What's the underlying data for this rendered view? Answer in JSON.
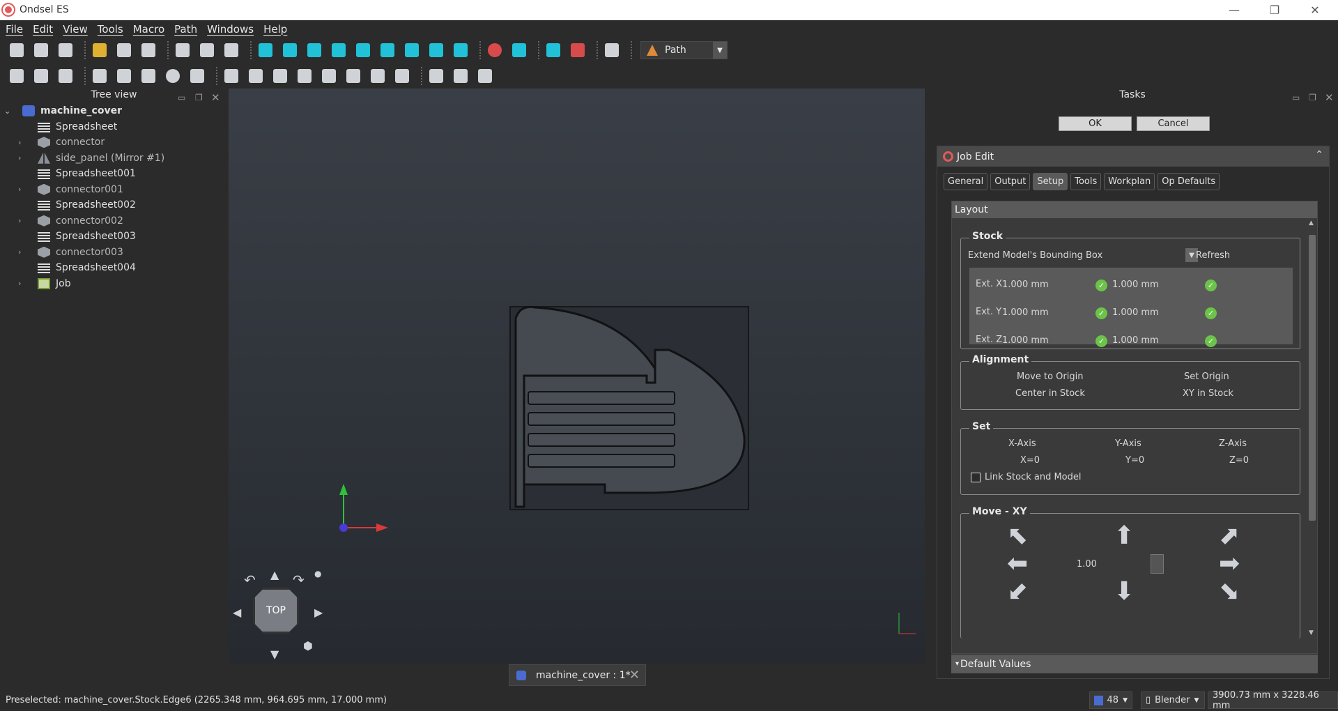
{
  "app": {
    "title": "Ondsel ES"
  },
  "menu": [
    "File",
    "Edit",
    "View",
    "Tools",
    "Macro",
    "Path",
    "Windows",
    "Help"
  ],
  "toolbar": {
    "workbench": "Path"
  },
  "tree": {
    "header": "Tree view",
    "items": [
      {
        "label": "machine_cover",
        "root": true
      },
      {
        "label": "Spreadsheet"
      },
      {
        "label": "connector"
      },
      {
        "label": "side_panel (Mirror #1)"
      },
      {
        "label": "Spreadsheet001"
      },
      {
        "label": "connector001"
      },
      {
        "label": "Spreadsheet002"
      },
      {
        "label": "connector002"
      },
      {
        "label": "Spreadsheet003"
      },
      {
        "label": "connector003"
      },
      {
        "label": "Spreadsheet004"
      },
      {
        "label": "Job"
      }
    ]
  },
  "viewport": {
    "navcube_face": "TOP",
    "tab_label": "machine_cover : 1*"
  },
  "tasks": {
    "header": "Tasks",
    "ok_label": "OK",
    "cancel_label": "Cancel",
    "panel_title": "Job Edit",
    "tabs": [
      "General",
      "Output",
      "Setup",
      "Tools",
      "Workplan",
      "Op Defaults"
    ],
    "active_tab": "Setup",
    "layout_label": "Layout",
    "stock": {
      "title": "Stock",
      "mode": "Extend Model's Bounding Box",
      "refresh_label": "Refresh",
      "ext": [
        {
          "label": "Ext. X",
          "neg": "1.000 mm",
          "pos": "1.000 mm"
        },
        {
          "label": "Ext. Y",
          "neg": "1.000 mm",
          "pos": "1.000 mm"
        },
        {
          "label": "Ext. Z",
          "neg": "1.000 mm",
          "pos": "1.000 mm"
        }
      ]
    },
    "alignment": {
      "title": "Alignment",
      "move_to_origin": "Move to Origin",
      "set_origin": "Set Origin",
      "center_in_stock": "Center in Stock",
      "xy_in_stock": "XY in Stock"
    },
    "set": {
      "title": "Set",
      "x_axis": "X-Axis",
      "y_axis": "Y-Axis",
      "z_axis": "Z-Axis",
      "x0": "X=0",
      "y0": "Y=0",
      "z0": "Z=0",
      "link_label": "Link Stock and Model"
    },
    "move_xy": {
      "title": "Move - XY",
      "step": "1.00"
    },
    "default_values": "Default Values"
  },
  "status": {
    "preselected": "Preselected: machine_cover.Stock.Edge6 (2265.348 mm, 964.695 mm, 17.000 mm)",
    "fps": "48",
    "nav_style": "Blender",
    "dims": "3900.73 mm x 3228.46 mm"
  }
}
